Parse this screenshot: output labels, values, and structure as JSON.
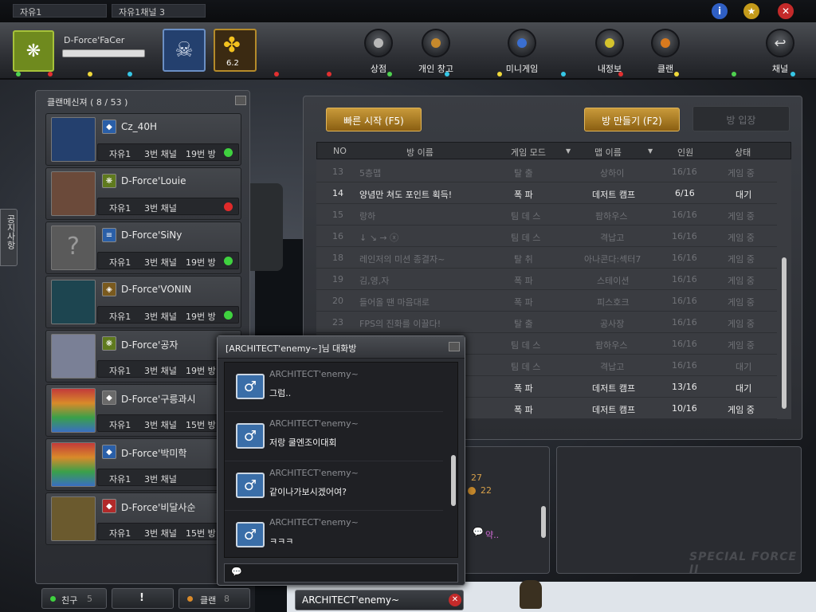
{
  "top": {
    "channel_server": "자유1",
    "channel_name": "자유1채널 3"
  },
  "profile": {
    "name": "D-Force'FaCer",
    "rank_value": "6.2"
  },
  "menu": [
    {
      "label": "상점",
      "color": "#b8b8b8"
    },
    {
      "label": "개인 창고",
      "color": "#c6892c"
    },
    {
      "label": "미니게임",
      "color": "#3a6fd1"
    },
    {
      "label": "내정보",
      "color": "#d4c32d"
    },
    {
      "label": "클랜",
      "color": "#d97a1e"
    },
    {
      "label": "채널",
      "color": "#cfcfcf"
    }
  ],
  "side_tab": "공지사항",
  "clan": {
    "title": "클랜메신져 ( 8 / 53 )",
    "members": [
      {
        "name": "Cz_40H",
        "server": "자유1",
        "channel": "3번 채널",
        "room": "19번 방",
        "online": "green"
      },
      {
        "name": "D-Force'Louie",
        "server": "자유1",
        "channel": "3번 채널",
        "room": "",
        "online": "red"
      },
      {
        "name": "D-Force'SiNy",
        "server": "자유1",
        "channel": "3번 채널",
        "room": "19번 방",
        "online": "green"
      },
      {
        "name": "D-Force'VONIN",
        "server": "자유1",
        "channel": "3번 채널",
        "room": "19번 방",
        "online": "green"
      },
      {
        "name": "D-Force'공자",
        "server": "자유1",
        "channel": "3번 채널",
        "room": "19번 방",
        "online": ""
      },
      {
        "name": "D-Force'구릉과시",
        "server": "자유1",
        "channel": "3번 채널",
        "room": "15번 방",
        "online": ""
      },
      {
        "name": "D-Force'박미학",
        "server": "자유1",
        "channel": "3번 채널",
        "room": "",
        "online": ""
      },
      {
        "name": "D-Force'비달사순",
        "server": "자유1",
        "channel": "3번 채널",
        "room": "15번 방",
        "online": ""
      }
    ]
  },
  "rooms": {
    "quick_start": "빠른 시작 (F5)",
    "create": "방 만들기 (F2)",
    "enter": "방 입장",
    "headers": [
      "NO",
      "방 이름",
      "게임 모드",
      "맵 이름",
      "인원",
      "상태"
    ],
    "rows": [
      {
        "no": "13",
        "name": "5층맵",
        "mode": "탈 출",
        "map": "상하이",
        "players": "16/16",
        "status": "게임 중",
        "style": "dim"
      },
      {
        "no": "14",
        "name": "양념만 쳐도 포인트 획득!",
        "mode": "폭 파",
        "map": "데저트 캠프",
        "players": "6/16",
        "status": "대기",
        "style": "bright"
      },
      {
        "no": "15",
        "name": "랑하",
        "mode": "팀 데 스",
        "map": "팜하우스",
        "players": "16/16",
        "status": "게임 중",
        "style": "dim"
      },
      {
        "no": "16",
        "name": "↓ ↘ → ⓧ",
        "mode": "팀 데 스",
        "map": "격납고",
        "players": "16/16",
        "status": "게임 중",
        "style": "dim"
      },
      {
        "no": "18",
        "name": "레인저의 미션 종결자~",
        "mode": "탈 취",
        "map": "아나콘다:섹터7",
        "players": "16/16",
        "status": "게임 중",
        "style": "dim"
      },
      {
        "no": "19",
        "name": "김,영,자",
        "mode": "폭 파",
        "map": "스테이션",
        "players": "16/16",
        "status": "게임 중",
        "style": "dim"
      },
      {
        "no": "20",
        "name": "들어올 땐 마음대로",
        "mode": "폭 파",
        "map": "피스호크",
        "players": "16/16",
        "status": "게임 중",
        "style": "dim"
      },
      {
        "no": "23",
        "name": "FPS의 진화를 이끌다!",
        "mode": "탈 출",
        "map": "공사장",
        "players": "16/16",
        "status": "게임 중",
        "style": "dim"
      },
      {
        "no": "",
        "name": "",
        "mode": "팀 데 스",
        "map": "팜하우스",
        "players": "16/16",
        "status": "게임 중",
        "style": "dim"
      },
      {
        "no": "",
        "name": "",
        "mode": "팀 데 스",
        "map": "격납고",
        "players": "16/16",
        "status": "대기",
        "style": "dim"
      },
      {
        "no": "",
        "name": "",
        "mode": "폭 파",
        "map": "데저트 캠프",
        "players": "13/16",
        "status": "대기",
        "style": "bright"
      },
      {
        "no": "",
        "name": "",
        "mode": "폭 파",
        "map": "데저트 캠프",
        "players": "10/16",
        "status": "게임 중",
        "style": "bright"
      }
    ]
  },
  "chat": {
    "title": "[ARCHITECT'enemy~]님 대화방",
    "messages": [
      {
        "sender": "ARCHITECT'enemy~",
        "text": "그럼.."
      },
      {
        "sender": "ARCHITECT'enemy~",
        "text": "저랑 쿨엔조이대회"
      },
      {
        "sender": "ARCHITECT'enemy~",
        "text": "같이나가보시겠어여?"
      },
      {
        "sender": "ARCHITECT'enemy~",
        "text": "ㅋㅋㅋ"
      }
    ],
    "side_values": [
      "27",
      "22"
    ],
    "side_text": "약.."
  },
  "bottom": {
    "friend_label": "친구",
    "friend_count": "5",
    "alert": "!",
    "clan_label": "클랜",
    "clan_count": "8",
    "chat_tab": "ARCHITECT'enemy~",
    "watermark": "SPECIAL FORCE II"
  }
}
